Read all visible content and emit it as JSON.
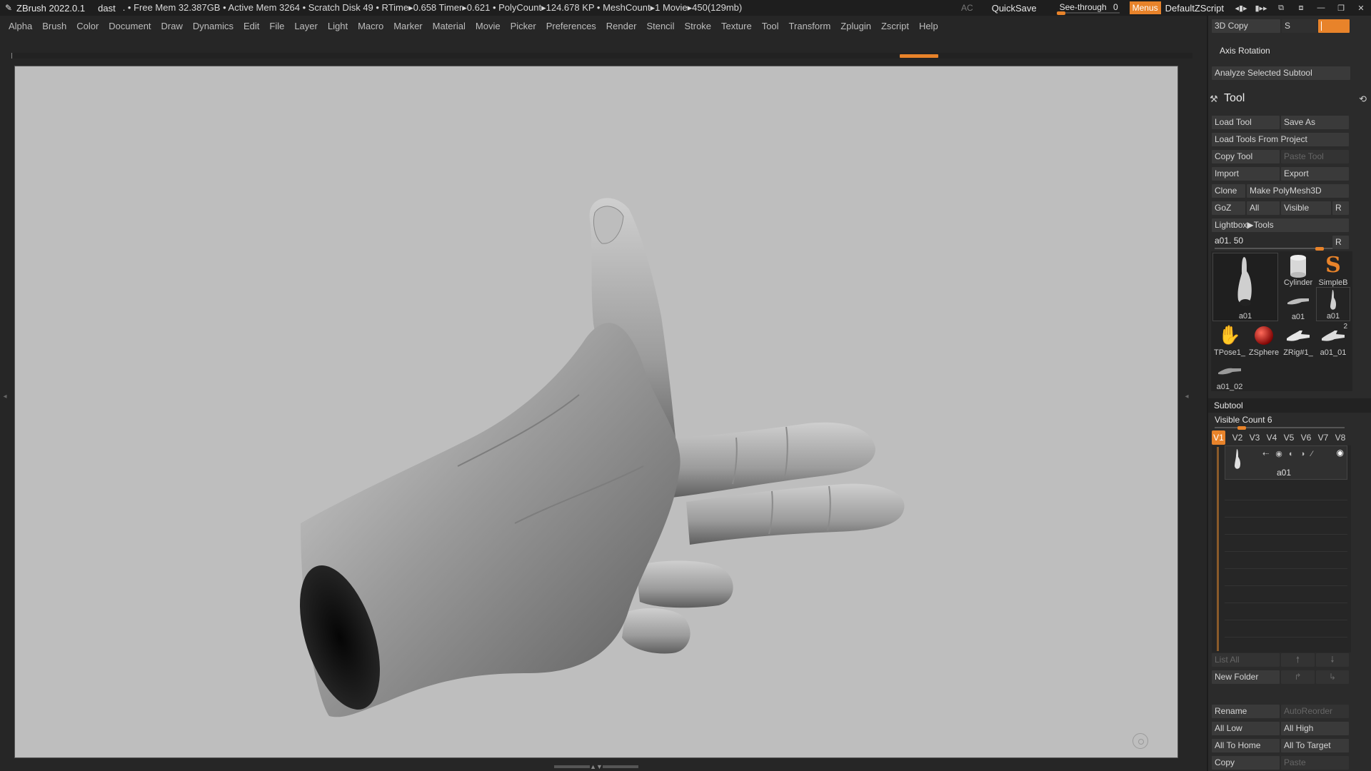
{
  "titlebar": {
    "app_title": "ZBrush 2022.0.1",
    "document": "dast",
    "stats": ". • Free Mem 32.387GB • Active Mem 3264 • Scratch Disk 49 • RTime▸0.658 Timer▸0.621 • PolyCount▸124.678 KP  • MeshCount▸1  Movie▸450(129mb)",
    "ac": "AC",
    "quicksave": "QuickSave",
    "seethrough_label": "See-through",
    "seethrough_value": "0",
    "menus": "Menus",
    "script": "DefaultZScript"
  },
  "menubar": {
    "items": [
      "Alpha",
      "Brush",
      "Color",
      "Document",
      "Draw",
      "Dynamics",
      "Edit",
      "File",
      "Layer",
      "Light",
      "Macro",
      "Marker",
      "Material",
      "Movie",
      "Picker",
      "Preferences",
      "Render",
      "Stencil",
      "Stroke",
      "Texture",
      "Tool",
      "Transform",
      "Zplugin",
      "Zscript",
      "Help"
    ]
  },
  "panel": {
    "top": {
      "copy3d": "3D Copy",
      "s_label": "S",
      "axis_rotation": "Axis Rotation",
      "analyze": "Analyze Selected Subtool"
    },
    "tool": {
      "title": "Tool",
      "load_tool": "Load Tool",
      "save_as": "Save As",
      "load_from_project": "Load Tools From Project",
      "copy_tool": "Copy Tool",
      "paste_tool": "Paste Tool",
      "import": "Import",
      "export": "Export",
      "clone": "Clone",
      "make_polymesh": "Make PolyMesh3D",
      "goz": "GoZ",
      "all": "All",
      "visible": "Visible",
      "r": "R",
      "lightbox": "Lightbox▶Tools",
      "current_tool": "a01. 50",
      "slider_r": "R"
    },
    "thumbnails": [
      {
        "name": "a01"
      },
      {
        "name": "Cylinder"
      },
      {
        "name": "SimpleB"
      },
      {
        "name": "a01"
      },
      {
        "name": "a01"
      },
      {
        "name": "TPose1_"
      },
      {
        "name": "ZSphere"
      },
      {
        "name": "ZRig#1_"
      },
      {
        "name": "a01_01"
      },
      {
        "name": "a01_02"
      }
    ],
    "thumb_badge": "2",
    "subtool": {
      "title": "Subtool",
      "visible_count": "Visible Count 6",
      "versions": [
        "V1",
        "V2",
        "V3",
        "V4",
        "V5",
        "V6",
        "V7",
        "V8"
      ],
      "item_name": "a01",
      "list_all": "List All",
      "new_folder": "New Folder",
      "rename": "Rename",
      "auto_reorder": "AutoReorder",
      "all_low": "All Low",
      "all_high": "All High",
      "all_to_home": "All To Home",
      "all_to_target": "All To Target",
      "copy": "Copy",
      "paste": "Paste"
    }
  },
  "colors": {
    "accent": "#e8832a",
    "viewport_bg": "#bebebe",
    "panel_bg": "#2b2b2b"
  }
}
